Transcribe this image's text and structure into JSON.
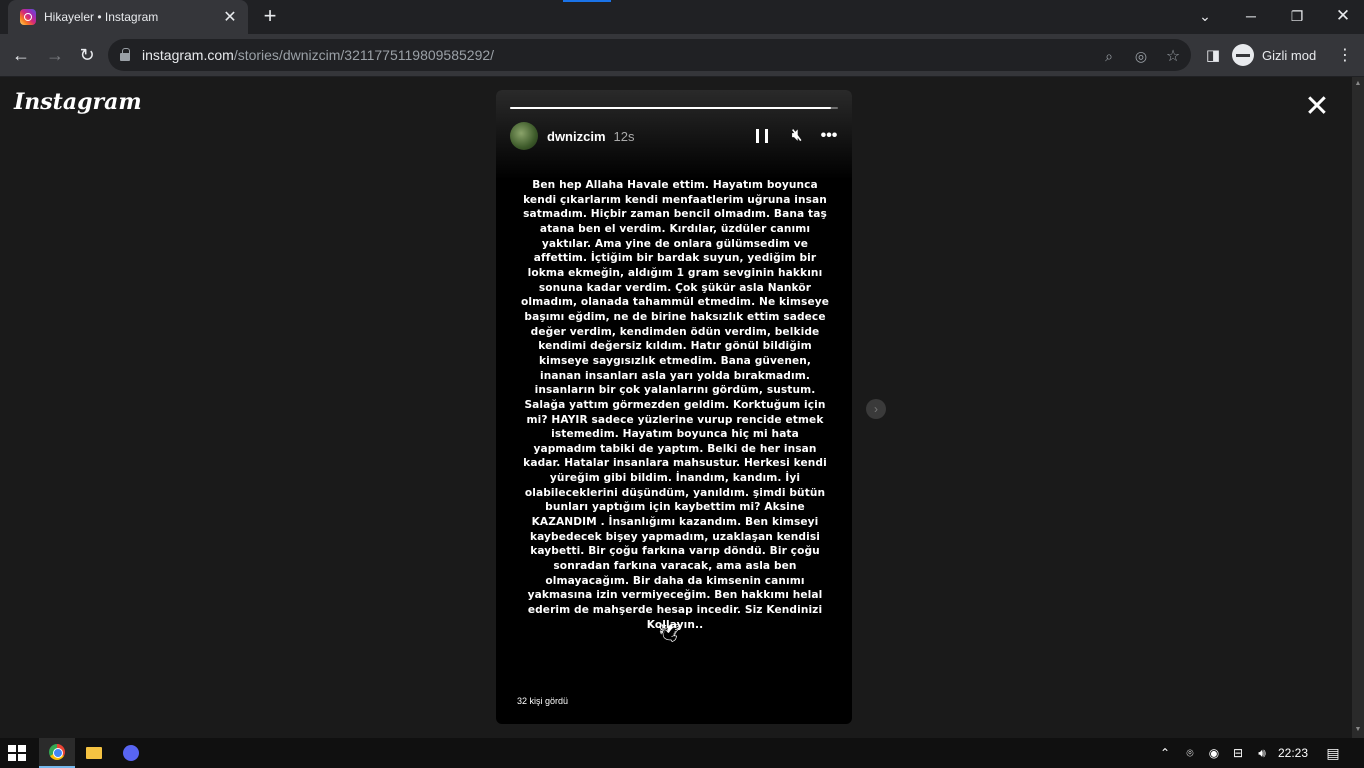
{
  "browser": {
    "tab_title": "Hikayeler • Instagram",
    "url_domain": "instagram.com",
    "url_path": "/stories/dwnizcim/3211775119809585292/",
    "incognito_label": "Gizli mod"
  },
  "page": {
    "logo": "Instagram",
    "close_symbol": "✕"
  },
  "story": {
    "progress": 0.98,
    "username": "dwnizcim",
    "time": "12s",
    "text": "Ben hep Allaha Havale ettim. Hayatım boyunca kendi çıkarlarım kendi menfaatlerim uğruna insan satmadım. Hiçbir zaman bencil olmadım. Bana taş atana ben el verdim. Kırdılar, üzdüler canımı yaktılar. Ama yine de onlara gülümsedim ve affettim. İçtiğim bir bardak suyun, yediğim bir lokma ekmeğin, aldığım 1 gram sevginin hakkını sonuna kadar verdim. Çok şükür asla Nankör olmadım, olanada tahammül etmedim. Ne kimseye başımı eğdim, ne de birine haksızlık ettim sadece değer verdim, kendimden ödün verdim, belkide kendimi değersiz kıldım. Hatır gönül bildiğim kimseye saygısızlık etmedim. Bana güvenen, inanan insanları asla yarı yolda bırakmadım. insanların bir çok yalanlarını gördüm, sustum. Salağa yattım görmezden geldim. Korktuğum için mi? HAYIR sadece yüzlerine vurup rencide etmek istemedim. Hayatım boyunca hiç mi hata yapmadım tabiki de yaptım. Belki de her insan kadar. Hatalar insanlara mahsustur. Herkesi kendi yüreğim gibi bildim. İnandım, kandım. İyi olabileceklerini düşündüm, yanıldım. şimdi bütün bunları yaptığım için kaybettim mi? Aksine KAZANDIM . İnsanlığımı kazandım. Ben kimseyi kaybedecek bişey yapmadım, uzaklaşan kendisi kaybetti. Bir çoğu farkına varıp döndü. Bir çoğu sonradan farkına varacak, ama asla ben olmayacağım. Bir daha da kimsenin canımı yakmasına izin vermiyeceğim. Ben hakkımı helal ederim de mahşerde hesap incedir. Siz Kendinizi Kollayın..",
    "viewers": "32 kişi gördü"
  },
  "taskbar": {
    "time": "22:23"
  }
}
